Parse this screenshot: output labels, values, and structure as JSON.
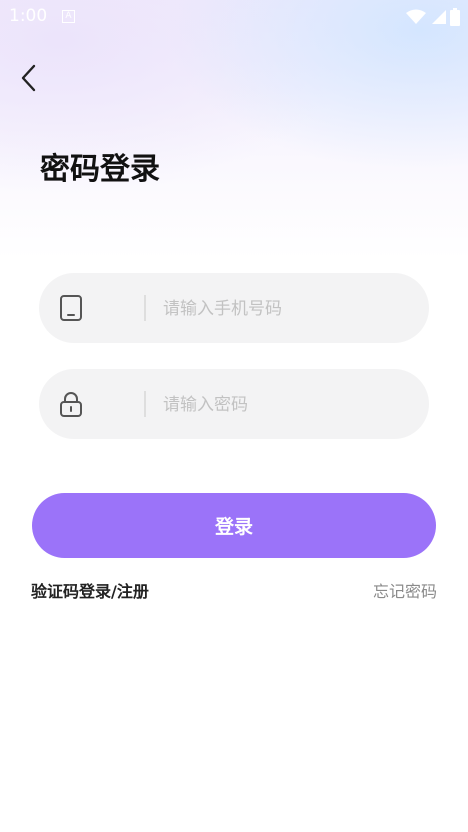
{
  "status_bar": {
    "time": "1:00",
    "notification_letter": "A",
    "icons": [
      "wifi-icon",
      "signal-icon",
      "battery-icon"
    ]
  },
  "page": {
    "title": "密码登录"
  },
  "form": {
    "phone_placeholder": "请输入手机号码",
    "password_placeholder": "请输入密码",
    "login_label": "登录"
  },
  "links": {
    "sms_login": "验证码登录/注册",
    "forgot_password": "忘记密码"
  },
  "colors": {
    "accent": "#9b73f9",
    "field_bg": "#f3f3f4",
    "placeholder": "#c2c2c2"
  }
}
